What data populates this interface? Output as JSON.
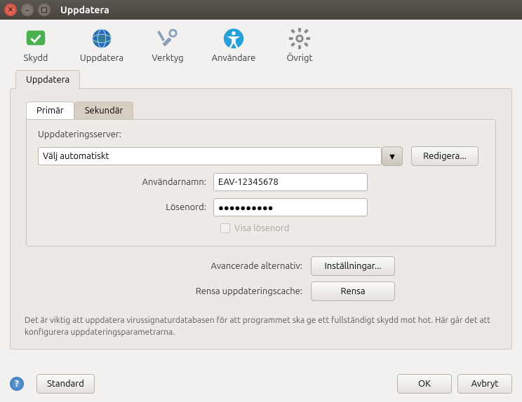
{
  "window": {
    "title": "Uppdatera"
  },
  "toolbar": {
    "protection": "Skydd",
    "update": "Uppdatera",
    "tools": "Verktyg",
    "users": "Användare",
    "other": "Övrigt"
  },
  "outer_tab": {
    "label": "Uppdatera"
  },
  "inner_tabs": {
    "primary": "Primär",
    "secondary": "Sekundär"
  },
  "form": {
    "server_label": "Uppdateringsserver:",
    "server_value": "Välj automatiskt",
    "edit_button": "Redigera...",
    "username_label": "Användarnamn:",
    "username_value": "EAV-12345678",
    "password_label": "Lösenord:",
    "password_value": "●●●●●●●●●●",
    "show_password": "Visa lösenord"
  },
  "advanced": {
    "options_label": "Avancerade alternativ:",
    "options_button": "Inställningar...",
    "clear_label": "Rensa uppdateringscache:",
    "clear_button": "Rensa"
  },
  "description": "Det är viktig att uppdatera virussignaturdatabasen för att programmet ska ge ett fullständigt skydd mot hot. Här går det att konfigurera uppdateringsparametrarna.",
  "buttons": {
    "default": "Standard",
    "ok": "OK",
    "cancel": "Avbryt"
  }
}
